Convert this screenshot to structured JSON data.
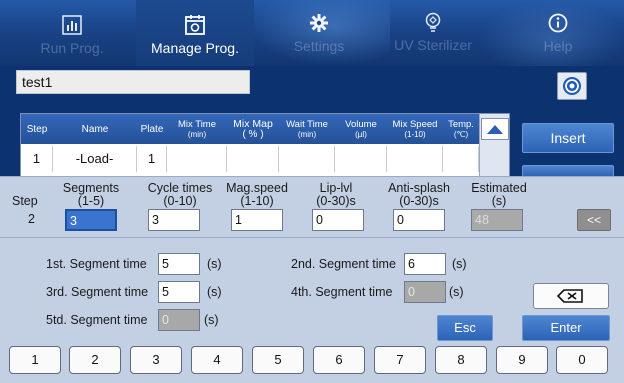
{
  "nav": {
    "tabs": [
      {
        "label": "Run Prog.",
        "icon": "chart-icon"
      },
      {
        "label": "Manage Prog.",
        "icon": "calendar-icon"
      },
      {
        "label": "Settings",
        "icon": "gear-icon"
      },
      {
        "label": "UV Sterilizer",
        "icon": "uv-lamp-icon"
      },
      {
        "label": "Help",
        "icon": "info-icon"
      }
    ]
  },
  "program": {
    "name": "test1",
    "action_icon": "target-icon"
  },
  "table": {
    "headers": [
      {
        "label": "Step"
      },
      {
        "label": "Name"
      },
      {
        "label": "Plate"
      },
      {
        "label": "Mix Time",
        "sub": "(min)"
      },
      {
        "label": "Mix Map",
        "sub": "( % )"
      },
      {
        "label": "Wait Time",
        "sub": "(min)"
      },
      {
        "label": "Volume",
        "sub": "(µl)"
      },
      {
        "label": "Mix Speed",
        "sub": "(1-10)"
      },
      {
        "label": "Temp.",
        "sub": "(℃)"
      }
    ],
    "rows": [
      {
        "step": "1",
        "name": "-Load-",
        "plate": "1"
      }
    ]
  },
  "side_buttons": {
    "insert": "Insert"
  },
  "params": {
    "step_label": "Step",
    "step_value": "2",
    "fields": [
      {
        "label": "Segments",
        "range": "(1-5)",
        "value": "3",
        "state": "selected"
      },
      {
        "label": "Cycle times",
        "range": "(0-10)",
        "value": "3",
        "state": "normal"
      },
      {
        "label": "Mag.speed",
        "range": "(1-10)",
        "value": "1",
        "state": "normal"
      },
      {
        "label": "Lip-lvl",
        "range": "(0-30)s",
        "value": "0",
        "state": "normal"
      },
      {
        "label": "Anti-splash",
        "range": "(0-30)s",
        "value": "0",
        "state": "normal"
      },
      {
        "label": "Estimated",
        "range": "(s)",
        "value": "48",
        "state": "disabled"
      }
    ],
    "back_label": "<<"
  },
  "segments": [
    {
      "label": "1st. Segment time",
      "value": "5",
      "unit": "(s)",
      "state": "normal"
    },
    {
      "label": "2nd. Segment time",
      "value": "6",
      "unit": "(s)",
      "state": "normal"
    },
    {
      "label": "3rd. Segment time",
      "value": "5",
      "unit": "(s)",
      "state": "normal"
    },
    {
      "label": "4th. Segment time",
      "value": "0",
      "unit": "(s)",
      "state": "disabled"
    },
    {
      "label": "5td. Segment time",
      "value": "0",
      "unit": "(s)",
      "state": "disabled"
    }
  ],
  "actions": {
    "esc": "Esc",
    "enter": "Enter",
    "delete_icon": "backspace-icon"
  },
  "keypad": [
    "1",
    "2",
    "3",
    "4",
    "5",
    "6",
    "7",
    "8",
    "9",
    "0"
  ],
  "colors": {
    "nav_bg": "#1a4488",
    "panel_bg": "#c3cfe3",
    "accent": "#2d63b5",
    "selected_input": "#3a74cf"
  }
}
